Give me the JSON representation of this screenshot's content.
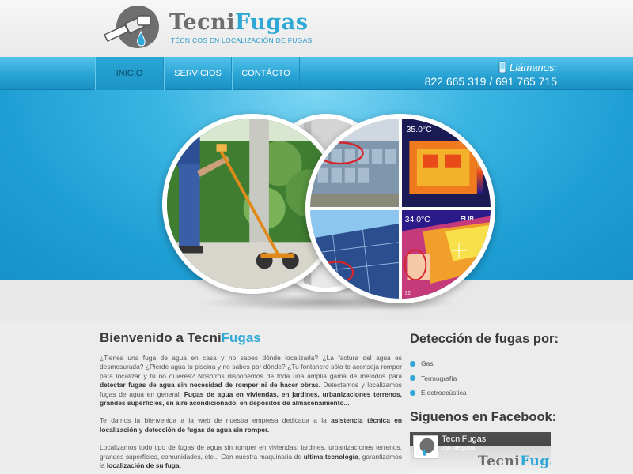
{
  "brand": {
    "name_part1": "Tecni",
    "name_part2": "Fugas",
    "tagline": "TÉCNICOS EN LOCALIZACIÓN DE FUGAS"
  },
  "nav": {
    "items": [
      {
        "label": "INICIO"
      },
      {
        "label": "SERVICIOS"
      },
      {
        "label": "CONTÁCTO"
      }
    ]
  },
  "call": {
    "label": "Llámanos:",
    "phones": "822 665 319 / 691 765 715"
  },
  "hero": {
    "thermal_temp_top": "35.0°C",
    "thermal_temp_bottom": "34.0°C",
    "thermal_brand": "FLIR",
    "thermal_low": "22"
  },
  "main": {
    "title_part1": "Bienvenido a Tecni",
    "title_part2": "Fugas",
    "p1_a": "¿Tienes una fuga de agua en casa y no sabes dónde localizarla? ¿La factura del agua es desmesurada? ¿Pierde agua tu piscina y no sabes por dónde? ¿Tu fontanero sólo te aconseja romper para localizar y tú no quieres? Nosotros disponemos de toda una amplia gama de métodos para ",
    "p1_b": "detectar fugas de agua sin necesidad de romper ni de hacer obras.",
    "p1_c": " Detectamos y localizamos fugas de agua en general: ",
    "p1_d": "Fugas de agua en viviendas, en jardines, urbanizaciones terrenos, grandes superficies, en aire acondicionado, en depósitos de almacenamiento...",
    "p2_a": "Te damos la bienvenida a la web de nuestra empresa dedicada a la ",
    "p2_b": "asistencia técnica en localización y detección de fugas de agua sin romper.",
    "p3_a": "Localizamos todo tipo de fugas de agua sin romper en viviendas, jardines, urbanizaciones terrenos, grandes superficies, comunidades, etc... Con nuestra maquinaria de ",
    "p3_b": "ultima tecnología",
    "p3_c": ", garantizamos la ",
    "p3_d": "localización de su fuga."
  },
  "sidebar": {
    "detect_title": "Detección de fugas por:",
    "detect_items": [
      {
        "label": "Gas"
      },
      {
        "label": "Termografía"
      },
      {
        "label": "Electroacústica"
      }
    ],
    "fb_title": "Síguenos en Facebook:",
    "fb_page_name": "TecniFugas",
    "fb_likes": "260 Me gusta"
  },
  "colors": {
    "accent": "#2fa8d6",
    "nav_bg": "#27a2d3",
    "text": "#444444"
  },
  "icons": [
    "logo-mark-icon",
    "phone-icon",
    "bullet-icon"
  ]
}
